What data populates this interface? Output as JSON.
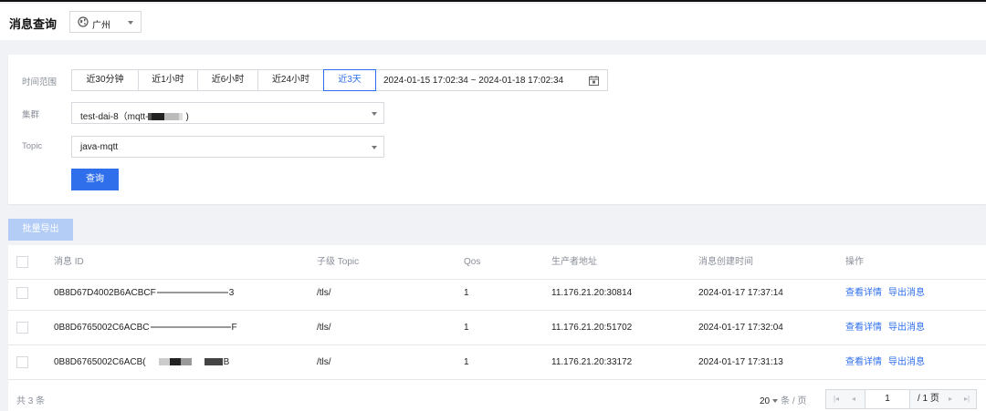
{
  "header": {
    "title": "消息查询",
    "region": "广州"
  },
  "filters": {
    "time_label": "时间范围",
    "time_options": [
      "近30分钟",
      "近1小时",
      "近6小时",
      "近24小时",
      "近3天"
    ],
    "time_active": "近3天",
    "range_text": "2024-01-15 17:02:34  ~ 2024-01-18 17:02:34",
    "cluster_label": "集群",
    "cluster_value_prefix": "test-dai-8（mqtt-",
    "cluster_value_suffix": ")",
    "topic_label": "Topic",
    "topic_value": "java-mqtt",
    "query_button": "查询"
  },
  "toolbar": {
    "batch_export": "批量导出"
  },
  "table": {
    "columns": [
      "消息 ID",
      "子级 Topic",
      "Qos",
      "生产者地址",
      "消息创建时间",
      "操作"
    ],
    "rows": [
      {
        "id": "0B8D67D4002B6ACBCF",
        "id_tail": "3",
        "topic": "/tls/",
        "qos": "1",
        "producer": "11.176.21.20:30814",
        "time": "2024-01-17 17:37:14"
      },
      {
        "id": "0B8D6765002C6ACBC",
        "id_tail": "F",
        "topic": "/tls/",
        "qos": "1",
        "producer": "11.176.21.20:51702",
        "time": "2024-01-17 17:32:04"
      },
      {
        "id": "0B8D6765002C6ACB(",
        "id_tail": "B",
        "topic": "/tls/",
        "qos": "1",
        "producer": "11.176.21.20:33172",
        "time": "2024-01-17 17:31:13"
      }
    ],
    "actions": [
      "查看详情",
      "导出消息"
    ]
  },
  "footer": {
    "total": "共 3 条",
    "page_size": "20",
    "page_size_unit": "条 / 页",
    "current_page": "1",
    "total_pages": "/ 1 页"
  },
  "colors": {
    "primary": "#2f6fec",
    "disabled_primary": "#b3cdf6"
  },
  "icons": [
    "globe-icon",
    "calendar-icon",
    "chevron-down-icon",
    "first-page-icon",
    "prev-page-icon",
    "next-page-icon",
    "last-page-icon"
  ]
}
